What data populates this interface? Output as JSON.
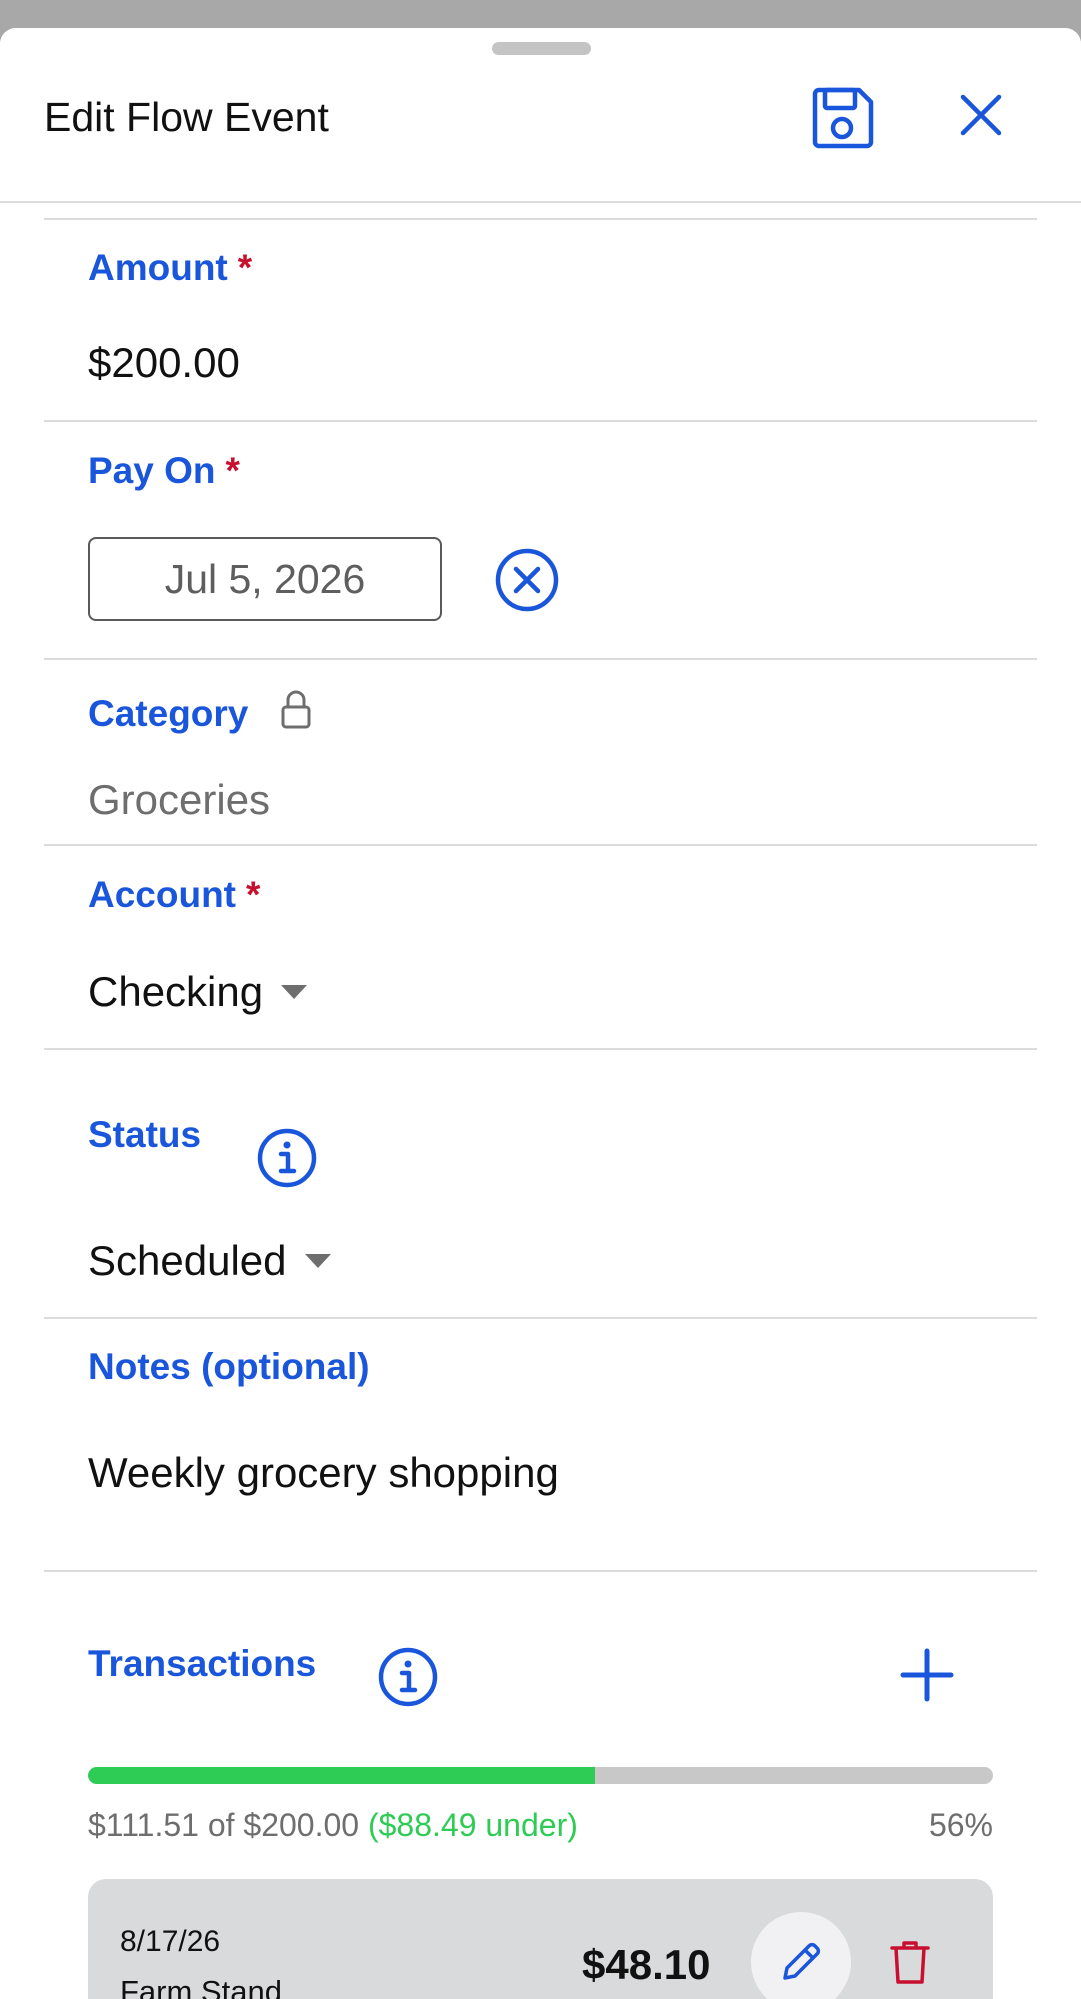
{
  "header": {
    "title": "Edit Flow Event",
    "save_icon": "floppy-disk-icon",
    "close_icon": "x-close-icon"
  },
  "form": {
    "amount": {
      "label": "Amount",
      "required_mark": "*",
      "value": "$200.00"
    },
    "pay_on": {
      "label": "Pay On",
      "required_mark": "*",
      "value": "Jul 5, 2026"
    },
    "category": {
      "label": "Category",
      "value": "Groceries",
      "locked": true
    },
    "account": {
      "label": "Account",
      "required_mark": "*",
      "value": "Checking"
    },
    "status": {
      "label": "Status",
      "value": "Scheduled"
    },
    "notes": {
      "label": "Notes (optional)",
      "value": "Weekly grocery shopping"
    }
  },
  "transactions": {
    "label": "Transactions",
    "progress_fraction": 0.56,
    "spent_text": "$111.51 of $200.00",
    "under_text": "($88.49 under)",
    "percent_text": "56%",
    "items": [
      {
        "date": "8/17/26",
        "payee": "Farm Stand",
        "amount": "$48.10"
      }
    ]
  },
  "colors": {
    "accent": "#1a56db",
    "required": "#c8102e",
    "progress_fill": "#2ecc55",
    "delete": "#c8102e"
  }
}
